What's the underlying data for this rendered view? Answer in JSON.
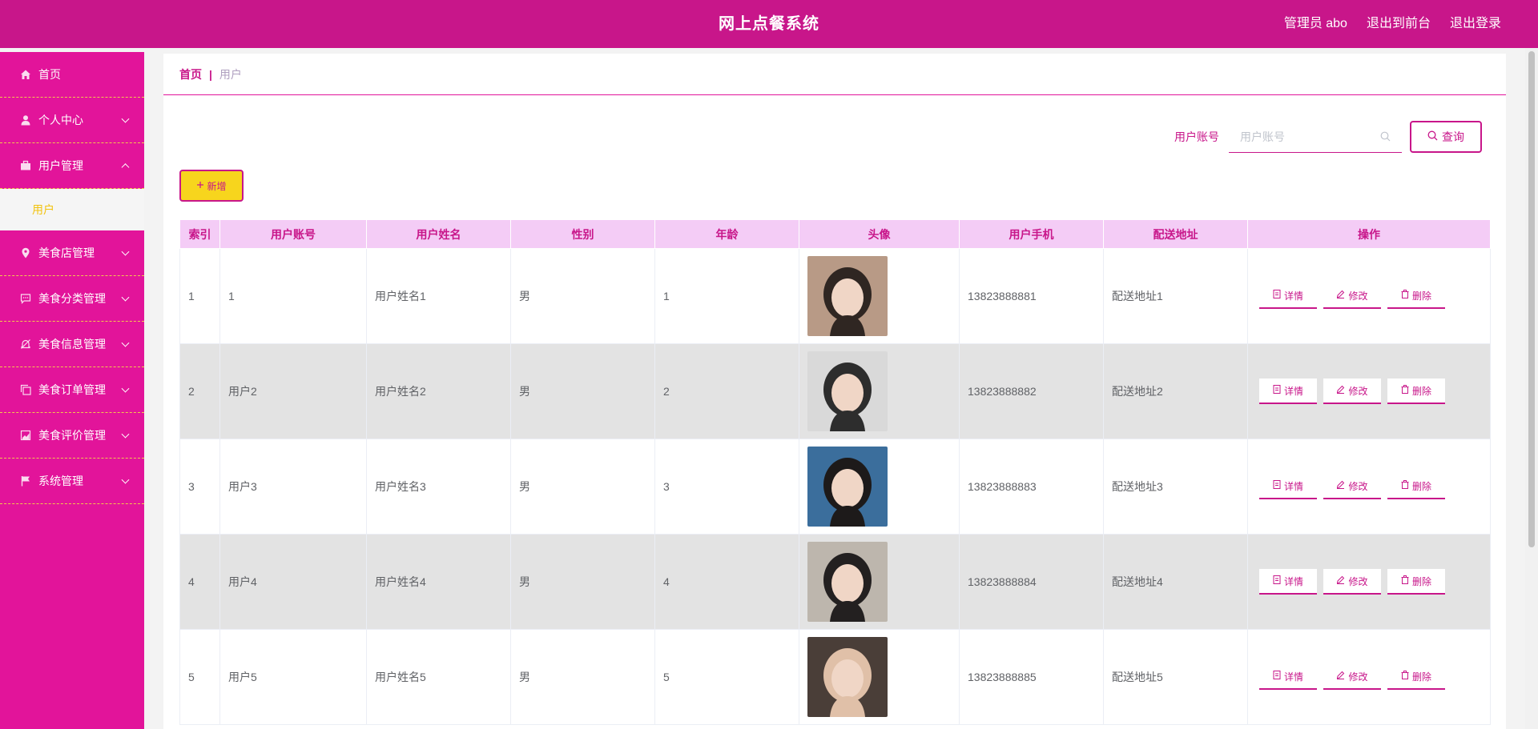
{
  "header": {
    "title": "网上点餐系统",
    "admin": "管理员 abo",
    "to_front": "退出到前台",
    "logout": "退出登录"
  },
  "sidebar": {
    "items": [
      {
        "label": "首页",
        "icon": "home-icon"
      },
      {
        "label": "个人中心",
        "icon": "user-icon"
      },
      {
        "label": "用户管理",
        "icon": "briefcase-icon",
        "expanded": true
      },
      {
        "label": "美食店管理",
        "icon": "location-icon"
      },
      {
        "label": "美食分类管理",
        "icon": "chat-icon"
      },
      {
        "label": "美食信息管理",
        "icon": "bell-off-icon"
      },
      {
        "label": "美食订单管理",
        "icon": "copy-icon"
      },
      {
        "label": "美食评价管理",
        "icon": "chart-icon"
      },
      {
        "label": "系统管理",
        "icon": "flag-icon"
      }
    ],
    "submenu": {
      "label": "用户"
    }
  },
  "breadcrumb": {
    "home": "首页",
    "separator": "|",
    "current": "用户"
  },
  "search": {
    "label": "用户账号",
    "placeholder": "用户账号",
    "value": "",
    "button": "查询"
  },
  "add_button": "新增",
  "table": {
    "headers": [
      "索引",
      "用户账号",
      "用户姓名",
      "性别",
      "年龄",
      "头像",
      "用户手机",
      "配送地址",
      "操作"
    ],
    "rows": [
      {
        "index": "1",
        "account": "1",
        "name": "用户姓名1",
        "gender": "男",
        "age": "1",
        "phone": "13823888881",
        "address": "配送地址1",
        "avatar_bg": "#b89a86",
        "avatar_fg": "#2f2622"
      },
      {
        "index": "2",
        "account": "用户2",
        "name": "用户姓名2",
        "gender": "男",
        "age": "2",
        "phone": "13823888882",
        "address": "配送地址2",
        "avatar_bg": "#d9d9d9",
        "avatar_fg": "#2d2d2d"
      },
      {
        "index": "3",
        "account": "用户3",
        "name": "用户姓名3",
        "gender": "男",
        "age": "3",
        "phone": "13823888883",
        "address": "配送地址3",
        "avatar_bg": "#3b6e9c",
        "avatar_fg": "#1d1a1a"
      },
      {
        "index": "4",
        "account": "用户4",
        "name": "用户姓名4",
        "gender": "男",
        "age": "4",
        "phone": "13823888884",
        "address": "配送地址4",
        "avatar_bg": "#bdb6ad",
        "avatar_fg": "#232020"
      },
      {
        "index": "5",
        "account": "用户5",
        "name": "用户姓名5",
        "gender": "男",
        "age": "5",
        "phone": "13823888885",
        "address": "配送地址5",
        "avatar_bg": "#4a3e38",
        "avatar_fg": "#e0c0a8"
      }
    ],
    "actions": {
      "detail": "详情",
      "edit": "修改",
      "delete": "删除"
    }
  },
  "colors": {
    "primary": "#c8168a",
    "sidebar": "#e2149a",
    "accent": "#f7d51d",
    "header_row": "#f4ccf6"
  }
}
